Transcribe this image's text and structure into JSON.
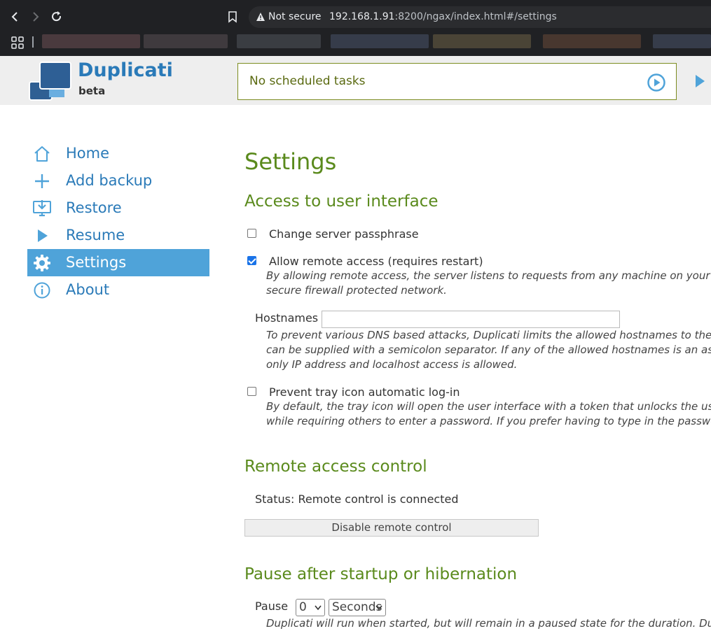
{
  "browser": {
    "security_label": "Not secure",
    "url_host": "192.168.1.91",
    "url_rest": ":8200/ngax/index.html#/settings"
  },
  "app": {
    "name": "Duplicati",
    "edition": "beta",
    "schedule_status": "No scheduled tasks",
    "brand_color": "#2a7ab8",
    "heading_color": "#5a8a1c",
    "active_nav_color": "#4fa3d9"
  },
  "sidebar": {
    "items": [
      {
        "label": "Home",
        "icon": "home-icon"
      },
      {
        "label": "Add backup",
        "icon": "plus-icon"
      },
      {
        "label": "Restore",
        "icon": "restore-icon"
      },
      {
        "label": "Resume",
        "icon": "play-icon"
      },
      {
        "label": "Settings",
        "icon": "gear-icon",
        "active": true
      },
      {
        "label": "About",
        "icon": "info-icon"
      }
    ]
  },
  "settings": {
    "title": "Settings",
    "access_section": "Access to user interface",
    "change_passphrase_label": "Change server passphrase",
    "change_passphrase_checked": false,
    "remote_access_label": "Allow remote access (requires restart)",
    "remote_access_checked": true,
    "remote_access_hint_1": "By allowing remote access, the server listens to requests from any machine on your netw",
    "remote_access_hint_2": "secure firewall protected network.",
    "hostnames_label": "Hostnames",
    "hostnames_value": "",
    "hostnames_hint_1": "To prevent various DNS based attacks, Duplicati limits the allowed hostnames to the ones",
    "hostnames_hint_2": "can be supplied with a semicolon separator. If any of the allowed hostnames is an asteris",
    "hostnames_hint_3": "only IP address and localhost access is allowed.",
    "tray_login_label": "Prevent tray icon automatic log-in",
    "tray_login_checked": false,
    "tray_hint_1": "By default, the tray icon will open the user interface with a token that unlocks the user in",
    "tray_hint_2": "while requiring others to enter a password. If you prefer having to type in the password,",
    "remote_control_section": "Remote access control",
    "remote_status": "Status: Remote control is connected",
    "disable_remote_label": "Disable remote control",
    "pause_section": "Pause after startup or hibernation",
    "pause_label": "Pause",
    "pause_value": "0",
    "pause_unit": "Seconds",
    "pause_hint": "Duplicati will run when started, but will remain in a paused state for the duration. Duplica"
  }
}
